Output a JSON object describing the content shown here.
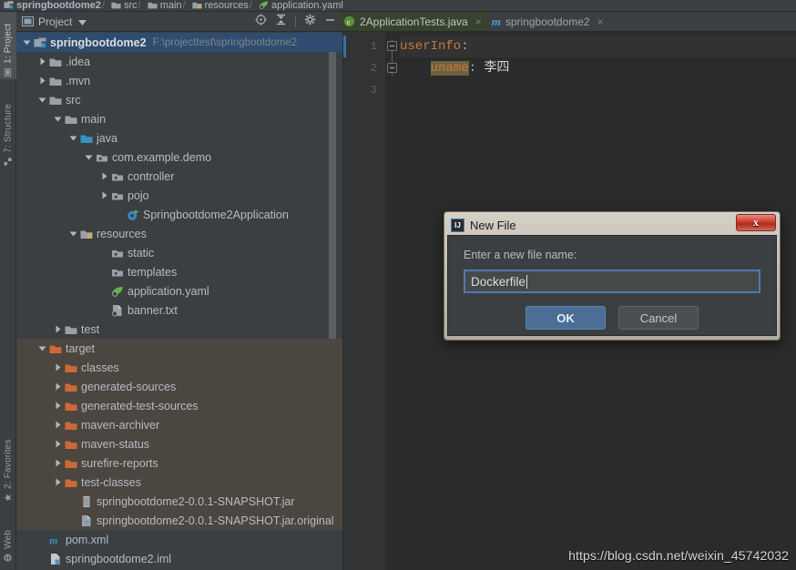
{
  "breadcrumb": [
    {
      "label": "springbootdome2",
      "icon": "module-icon",
      "bold": true
    },
    {
      "label": "src",
      "icon": "folder-icon",
      "bold": false
    },
    {
      "label": "main",
      "icon": "folder-icon",
      "bold": false
    },
    {
      "label": "resources",
      "icon": "resources-folder-icon",
      "bold": false
    },
    {
      "label": "application.yaml",
      "icon": "spring-yaml-icon",
      "bold": false
    }
  ],
  "tool_tabs": [
    {
      "label": "1: Project",
      "icon": "project-icon",
      "active": true
    },
    {
      "label": "7: Structure",
      "icon": "structure-icon",
      "active": false
    },
    {
      "label": "2: Favorites",
      "icon": "star-icon",
      "active": false
    },
    {
      "label": "Web",
      "icon": "web-icon",
      "active": false
    }
  ],
  "panel": {
    "title": "Project",
    "dropdown_icon": "chevron-down-icon",
    "header_icons": [
      {
        "name": "locate-icon"
      },
      {
        "name": "collapse-all-icon"
      },
      {
        "name": "settings-gear-icon"
      },
      {
        "name": "hide-panel-icon"
      }
    ]
  },
  "tree": [
    {
      "label": "springbootdome2",
      "sub": "F:\\projecttest\\springbootdome2",
      "indent": 0,
      "twisty": "down",
      "icon": "module-icon",
      "selected": true,
      "bold": true
    },
    {
      "label": ".idea",
      "indent": 1,
      "twisty": "right",
      "icon": "folder-icon"
    },
    {
      "label": ".mvn",
      "indent": 1,
      "twisty": "right",
      "icon": "folder-icon"
    },
    {
      "label": "src",
      "indent": 1,
      "twisty": "down",
      "icon": "folder-icon"
    },
    {
      "label": "main",
      "indent": 2,
      "twisty": "down",
      "icon": "folder-icon"
    },
    {
      "label": "java",
      "indent": 3,
      "twisty": "down",
      "icon": "source-folder-icon"
    },
    {
      "label": "com.example.demo",
      "indent": 4,
      "twisty": "down",
      "icon": "package-icon"
    },
    {
      "label": "controller",
      "indent": 5,
      "twisty": "right",
      "icon": "package-icon"
    },
    {
      "label": "pojo",
      "indent": 5,
      "twisty": "right",
      "icon": "package-icon"
    },
    {
      "label": "Springbootdome2Application",
      "indent": 6,
      "twisty": "none",
      "icon": "spring-class-icon"
    },
    {
      "label": "resources",
      "indent": 3,
      "twisty": "down",
      "icon": "resources-folder-icon"
    },
    {
      "label": "static",
      "indent": 5,
      "twisty": "none",
      "icon": "package-icon"
    },
    {
      "label": "templates",
      "indent": 5,
      "twisty": "none",
      "icon": "package-icon"
    },
    {
      "label": "application.yaml",
      "indent": 5,
      "twisty": "none",
      "icon": "spring-yaml-icon"
    },
    {
      "label": "banner.txt",
      "indent": 5,
      "twisty": "none",
      "icon": "text-file-icon"
    },
    {
      "label": "test",
      "indent": 2,
      "twisty": "right",
      "icon": "folder-icon"
    },
    {
      "label": "target",
      "indent": 1,
      "twisty": "down",
      "icon": "target-folder-icon",
      "target_bg": true
    },
    {
      "label": "classes",
      "indent": 2,
      "twisty": "right",
      "icon": "target-folder-icon",
      "target_bg": true
    },
    {
      "label": "generated-sources",
      "indent": 2,
      "twisty": "right",
      "icon": "target-folder-icon",
      "target_bg": true
    },
    {
      "label": "generated-test-sources",
      "indent": 2,
      "twisty": "right",
      "icon": "target-folder-icon",
      "target_bg": true
    },
    {
      "label": "maven-archiver",
      "indent": 2,
      "twisty": "right",
      "icon": "target-folder-icon",
      "target_bg": true
    },
    {
      "label": "maven-status",
      "indent": 2,
      "twisty": "right",
      "icon": "target-folder-icon",
      "target_bg": true
    },
    {
      "label": "surefire-reports",
      "indent": 2,
      "twisty": "right",
      "icon": "target-folder-icon",
      "target_bg": true
    },
    {
      "label": "test-classes",
      "indent": 2,
      "twisty": "right",
      "icon": "target-folder-icon",
      "target_bg": true
    },
    {
      "label": "springbootdome2-0.0.1-SNAPSHOT.jar",
      "indent": 3,
      "twisty": "none",
      "icon": "jar-file-icon",
      "target_bg": true
    },
    {
      "label": "springbootdome2-0.0.1-SNAPSHOT.jar.original",
      "indent": 3,
      "twisty": "none",
      "icon": "unknown-file-icon",
      "target_bg": true
    },
    {
      "label": "pom.xml",
      "indent": 1,
      "twisty": "none",
      "icon": "maven-icon"
    },
    {
      "label": "springbootdome2.iml",
      "indent": 1,
      "twisty": "none",
      "icon": "iml-file-icon"
    }
  ],
  "editor": {
    "tabs": [
      {
        "label": "2ApplicationTests.java",
        "icon": "java-class-icon",
        "active": true,
        "close": "×"
      },
      {
        "label": "springbootdome2",
        "icon": "maven-icon",
        "active": false,
        "close": "×"
      }
    ],
    "line_numbers": [
      "1",
      "2",
      "3"
    ],
    "code": {
      "line1_key": "userInfo",
      "line1_colon": ":",
      "line2_indent": "    ",
      "line2_key": "uname",
      "line2_colon": ": ",
      "line2_value": "李四"
    }
  },
  "dialog": {
    "title": "New File",
    "app_icon_text": "IJ",
    "close_label": "x",
    "prompt": "Enter a new file name:",
    "input_value": "Dockerfile",
    "input_placeholder": "",
    "ok_label": "OK",
    "cancel_label": "Cancel"
  },
  "watermark": "https://blog.csdn.net/weixin_45742032",
  "colors": {
    "panel_bg": "#3c3f41",
    "editor_bg": "#2b2b2b",
    "selection_blue": "#2f4c70",
    "target_bg": "#4b463f",
    "accent_orange": "#cc7832",
    "folder_orange": "#cd6939",
    "dialog_blue": "#4a6e96"
  }
}
